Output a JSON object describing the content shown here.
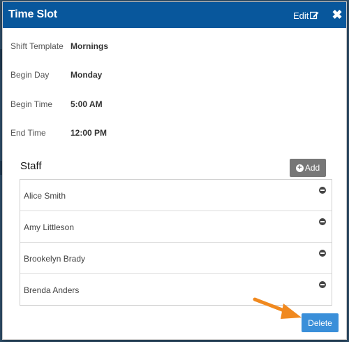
{
  "header": {
    "title": "Time Slot",
    "edit_label": "Edit",
    "close_symbol": "✖"
  },
  "fields": [
    {
      "label": "Shift Template",
      "value": "Mornings"
    },
    {
      "label": "Begin Day",
      "value": "Monday"
    },
    {
      "label": "Begin Time",
      "value": "5:00 AM"
    },
    {
      "label": "End Time",
      "value": "12:00 PM"
    }
  ],
  "staff": {
    "title": "Staff",
    "add_label": "Add",
    "members": [
      {
        "name": "Alice Smith"
      },
      {
        "name": "Amy Littleson"
      },
      {
        "name": "Brookelyn Brady"
      },
      {
        "name": "Brenda Anders"
      }
    ]
  },
  "footer": {
    "delete_label": "Delete"
  },
  "colors": {
    "header_bg": "#08579c",
    "delete_bg": "#3a8fd9",
    "add_bg": "#777777",
    "arrow": "#f0891f"
  },
  "icons": {
    "edit": "edit-icon",
    "close": "close-icon",
    "add": "plus-circle-icon",
    "remove": "minus-circle-icon",
    "annotation": "arrow-annotation"
  }
}
